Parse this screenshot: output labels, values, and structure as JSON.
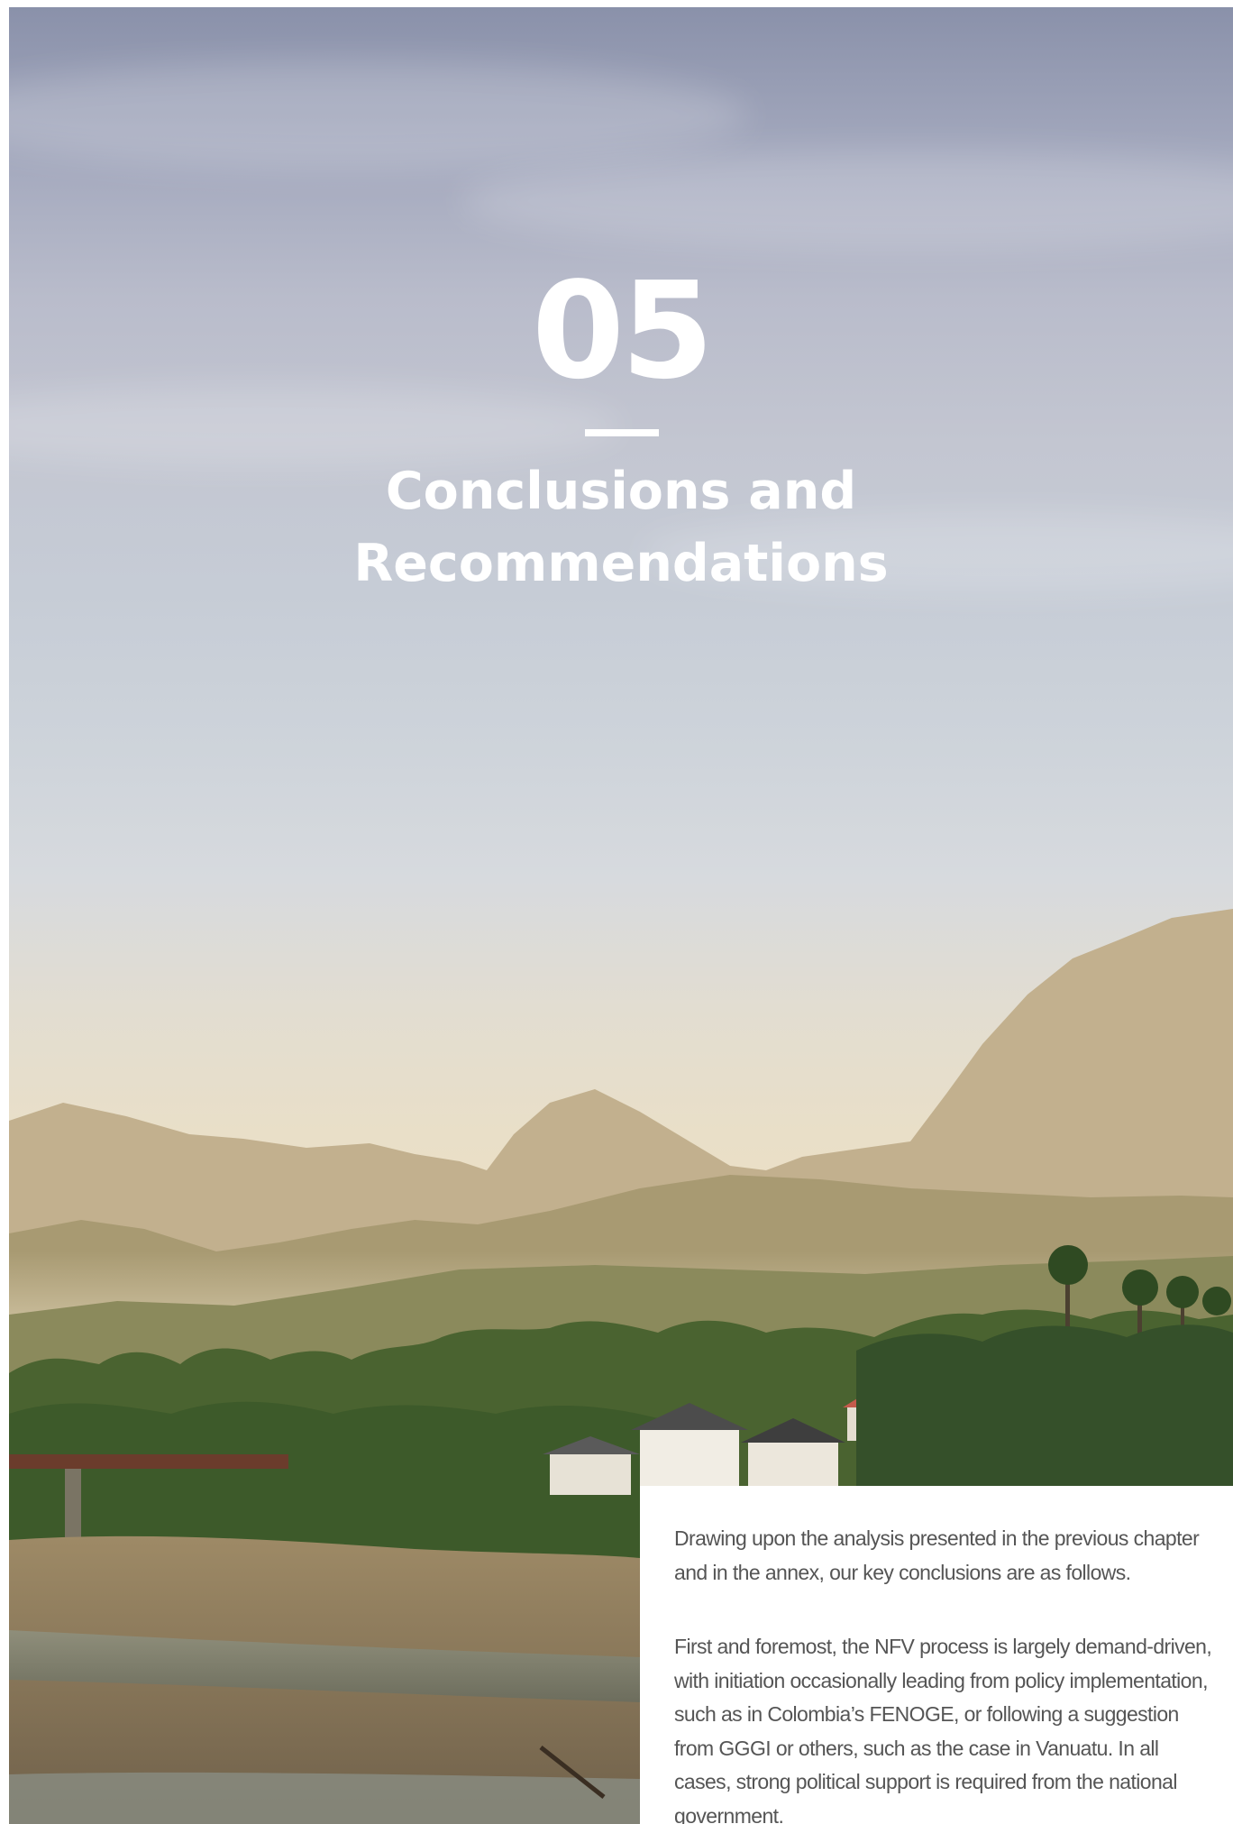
{
  "chapter": {
    "number": "05",
    "title_line1": "Conclusions and",
    "title_line2": "Recommendations"
  },
  "body": {
    "paragraphs": [
      "Drawing upon the analysis presented in the previous chapter and in the annex, our key conclusions are as follows.",
      "First and foremost, the NFV process is largely demand-driven, with initiation occasionally leading from policy implementation, such as in Colombia’s FENOGE, or following a suggestion from GGGI or others, such as the case in Vanuatu. In all cases, strong political support is required from the national government."
    ]
  },
  "colors": {
    "sky_top": "#8a91aa",
    "sky_horizon": "#ecdec2",
    "foliage": "#3d5a2a",
    "text": "#555555",
    "heading": "#ffffff"
  }
}
